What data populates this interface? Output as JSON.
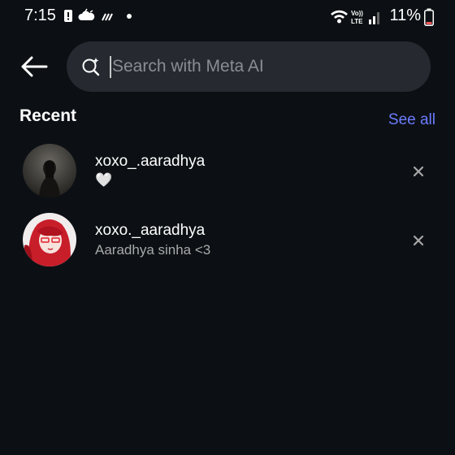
{
  "status_bar": {
    "time": "7:15",
    "left_icons": [
      "notification-icon",
      "cloud-icon",
      "signal-swirl-icon",
      "dot-icon"
    ],
    "right_icons": [
      "wifi-icon",
      "volte-icon",
      "signal-bars-icon",
      "battery-icon"
    ],
    "volte_label_top": "Vo))",
    "volte_label_bottom": "LTE",
    "battery_percent": "11%"
  },
  "header": {
    "back_icon": "arrow-left-icon",
    "search_icon": "meta-ai-search-icon",
    "search_placeholder": "Search with Meta AI",
    "search_value": ""
  },
  "recent": {
    "title": "Recent",
    "see_all_label": "See all",
    "accent_color": "#6c7cff",
    "items": [
      {
        "username": "xoxo_.aaradhya",
        "subtitle": "🤍",
        "avatar": "avatar-dark-photo"
      },
      {
        "username": "xoxo._aaradhya",
        "subtitle": "Aaradhya sinha <3",
        "avatar": "avatar-red-hair-illustration"
      }
    ]
  },
  "colors": {
    "background": "#0c1014",
    "search_bg": "#262a30",
    "secondary_text": "#a8a8a8"
  }
}
